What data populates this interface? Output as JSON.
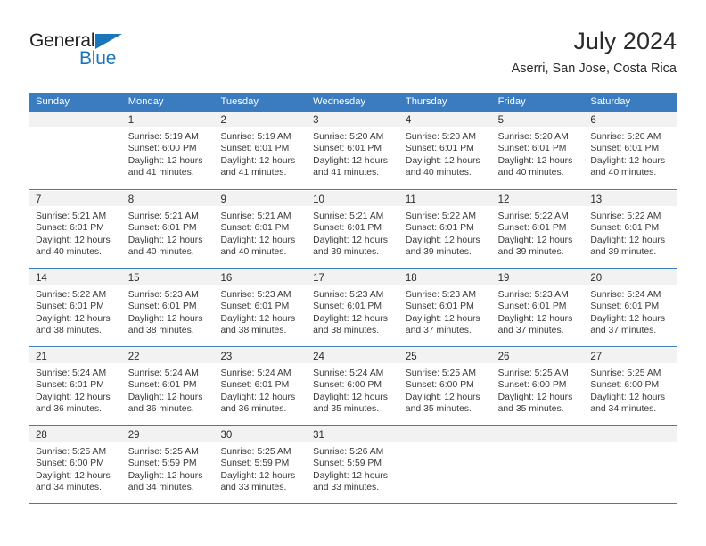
{
  "brand": {
    "name_part1": "General",
    "name_part2": "Blue",
    "accent_color": "#1b75bb"
  },
  "header": {
    "title": "July 2024",
    "subtitle": "Aserri, San Jose, Costa Rica"
  },
  "calendar": {
    "header_bg": "#3a7cbf",
    "daynum_bg": "#f2f2f2",
    "weekdays": [
      "Sunday",
      "Monday",
      "Tuesday",
      "Wednesday",
      "Thursday",
      "Friday",
      "Saturday"
    ],
    "weeks": [
      [
        {
          "day": "",
          "lines": []
        },
        {
          "day": "1",
          "lines": [
            "Sunrise: 5:19 AM",
            "Sunset: 6:00 PM",
            "Daylight: 12 hours",
            "and 41 minutes."
          ]
        },
        {
          "day": "2",
          "lines": [
            "Sunrise: 5:19 AM",
            "Sunset: 6:01 PM",
            "Daylight: 12 hours",
            "and 41 minutes."
          ]
        },
        {
          "day": "3",
          "lines": [
            "Sunrise: 5:20 AM",
            "Sunset: 6:01 PM",
            "Daylight: 12 hours",
            "and 41 minutes."
          ]
        },
        {
          "day": "4",
          "lines": [
            "Sunrise: 5:20 AM",
            "Sunset: 6:01 PM",
            "Daylight: 12 hours",
            "and 40 minutes."
          ]
        },
        {
          "day": "5",
          "lines": [
            "Sunrise: 5:20 AM",
            "Sunset: 6:01 PM",
            "Daylight: 12 hours",
            "and 40 minutes."
          ]
        },
        {
          "day": "6",
          "lines": [
            "Sunrise: 5:20 AM",
            "Sunset: 6:01 PM",
            "Daylight: 12 hours",
            "and 40 minutes."
          ]
        }
      ],
      [
        {
          "day": "7",
          "lines": [
            "Sunrise: 5:21 AM",
            "Sunset: 6:01 PM",
            "Daylight: 12 hours",
            "and 40 minutes."
          ]
        },
        {
          "day": "8",
          "lines": [
            "Sunrise: 5:21 AM",
            "Sunset: 6:01 PM",
            "Daylight: 12 hours",
            "and 40 minutes."
          ]
        },
        {
          "day": "9",
          "lines": [
            "Sunrise: 5:21 AM",
            "Sunset: 6:01 PM",
            "Daylight: 12 hours",
            "and 40 minutes."
          ]
        },
        {
          "day": "10",
          "lines": [
            "Sunrise: 5:21 AM",
            "Sunset: 6:01 PM",
            "Daylight: 12 hours",
            "and 39 minutes."
          ]
        },
        {
          "day": "11",
          "lines": [
            "Sunrise: 5:22 AM",
            "Sunset: 6:01 PM",
            "Daylight: 12 hours",
            "and 39 minutes."
          ]
        },
        {
          "day": "12",
          "lines": [
            "Sunrise: 5:22 AM",
            "Sunset: 6:01 PM",
            "Daylight: 12 hours",
            "and 39 minutes."
          ]
        },
        {
          "day": "13",
          "lines": [
            "Sunrise: 5:22 AM",
            "Sunset: 6:01 PM",
            "Daylight: 12 hours",
            "and 39 minutes."
          ]
        }
      ],
      [
        {
          "day": "14",
          "lines": [
            "Sunrise: 5:22 AM",
            "Sunset: 6:01 PM",
            "Daylight: 12 hours",
            "and 38 minutes."
          ]
        },
        {
          "day": "15",
          "lines": [
            "Sunrise: 5:23 AM",
            "Sunset: 6:01 PM",
            "Daylight: 12 hours",
            "and 38 minutes."
          ]
        },
        {
          "day": "16",
          "lines": [
            "Sunrise: 5:23 AM",
            "Sunset: 6:01 PM",
            "Daylight: 12 hours",
            "and 38 minutes."
          ]
        },
        {
          "day": "17",
          "lines": [
            "Sunrise: 5:23 AM",
            "Sunset: 6:01 PM",
            "Daylight: 12 hours",
            "and 38 minutes."
          ]
        },
        {
          "day": "18",
          "lines": [
            "Sunrise: 5:23 AM",
            "Sunset: 6:01 PM",
            "Daylight: 12 hours",
            "and 37 minutes."
          ]
        },
        {
          "day": "19",
          "lines": [
            "Sunrise: 5:23 AM",
            "Sunset: 6:01 PM",
            "Daylight: 12 hours",
            "and 37 minutes."
          ]
        },
        {
          "day": "20",
          "lines": [
            "Sunrise: 5:24 AM",
            "Sunset: 6:01 PM",
            "Daylight: 12 hours",
            "and 37 minutes."
          ]
        }
      ],
      [
        {
          "day": "21",
          "lines": [
            "Sunrise: 5:24 AM",
            "Sunset: 6:01 PM",
            "Daylight: 12 hours",
            "and 36 minutes."
          ]
        },
        {
          "day": "22",
          "lines": [
            "Sunrise: 5:24 AM",
            "Sunset: 6:01 PM",
            "Daylight: 12 hours",
            "and 36 minutes."
          ]
        },
        {
          "day": "23",
          "lines": [
            "Sunrise: 5:24 AM",
            "Sunset: 6:01 PM",
            "Daylight: 12 hours",
            "and 36 minutes."
          ]
        },
        {
          "day": "24",
          "lines": [
            "Sunrise: 5:24 AM",
            "Sunset: 6:00 PM",
            "Daylight: 12 hours",
            "and 35 minutes."
          ]
        },
        {
          "day": "25",
          "lines": [
            "Sunrise: 5:25 AM",
            "Sunset: 6:00 PM",
            "Daylight: 12 hours",
            "and 35 minutes."
          ]
        },
        {
          "day": "26",
          "lines": [
            "Sunrise: 5:25 AM",
            "Sunset: 6:00 PM",
            "Daylight: 12 hours",
            "and 35 minutes."
          ]
        },
        {
          "day": "27",
          "lines": [
            "Sunrise: 5:25 AM",
            "Sunset: 6:00 PM",
            "Daylight: 12 hours",
            "and 34 minutes."
          ]
        }
      ],
      [
        {
          "day": "28",
          "lines": [
            "Sunrise: 5:25 AM",
            "Sunset: 6:00 PM",
            "Daylight: 12 hours",
            "and 34 minutes."
          ]
        },
        {
          "day": "29",
          "lines": [
            "Sunrise: 5:25 AM",
            "Sunset: 5:59 PM",
            "Daylight: 12 hours",
            "and 34 minutes."
          ]
        },
        {
          "day": "30",
          "lines": [
            "Sunrise: 5:25 AM",
            "Sunset: 5:59 PM",
            "Daylight: 12 hours",
            "and 33 minutes."
          ]
        },
        {
          "day": "31",
          "lines": [
            "Sunrise: 5:26 AM",
            "Sunset: 5:59 PM",
            "Daylight: 12 hours",
            "and 33 minutes."
          ]
        },
        {
          "day": "",
          "lines": []
        },
        {
          "day": "",
          "lines": []
        },
        {
          "day": "",
          "lines": []
        }
      ]
    ]
  }
}
